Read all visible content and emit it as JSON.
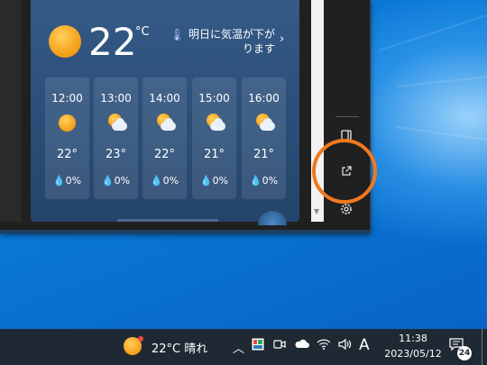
{
  "weather": {
    "temperature": "22",
    "unit": "°C",
    "alert_text": "明日に気温が下がります",
    "alert_icon": "thermometer-icon",
    "hourly": [
      {
        "time": "12:00",
        "icon": "sunny-icon",
        "temp": "22°",
        "rain": "0%"
      },
      {
        "time": "13:00",
        "icon": "partly-cloudy-icon",
        "temp": "23°",
        "rain": "0%"
      },
      {
        "time": "14:00",
        "icon": "partly-cloudy-icon",
        "temp": "22°",
        "rain": "0%"
      },
      {
        "time": "15:00",
        "icon": "partly-cloudy-icon",
        "temp": "21°",
        "rain": "0%"
      },
      {
        "time": "16:00",
        "icon": "partly-cloudy-icon",
        "temp": "21°",
        "rain": "0%"
      }
    ]
  },
  "sidebar": {
    "icons": [
      "pin-icon",
      "open-in-new-window-icon",
      "settings-icon"
    ],
    "highlight_color": "#f0781e"
  },
  "taskbar": {
    "weather_text": "22°C 晴れ",
    "ime_label": "A",
    "time": "11:38",
    "date": "2023/05/12",
    "notification_count": "24"
  },
  "colors": {
    "desktop": "#0a78d4",
    "taskbar": "#1f2933",
    "weather_card": "#2b4e78"
  }
}
